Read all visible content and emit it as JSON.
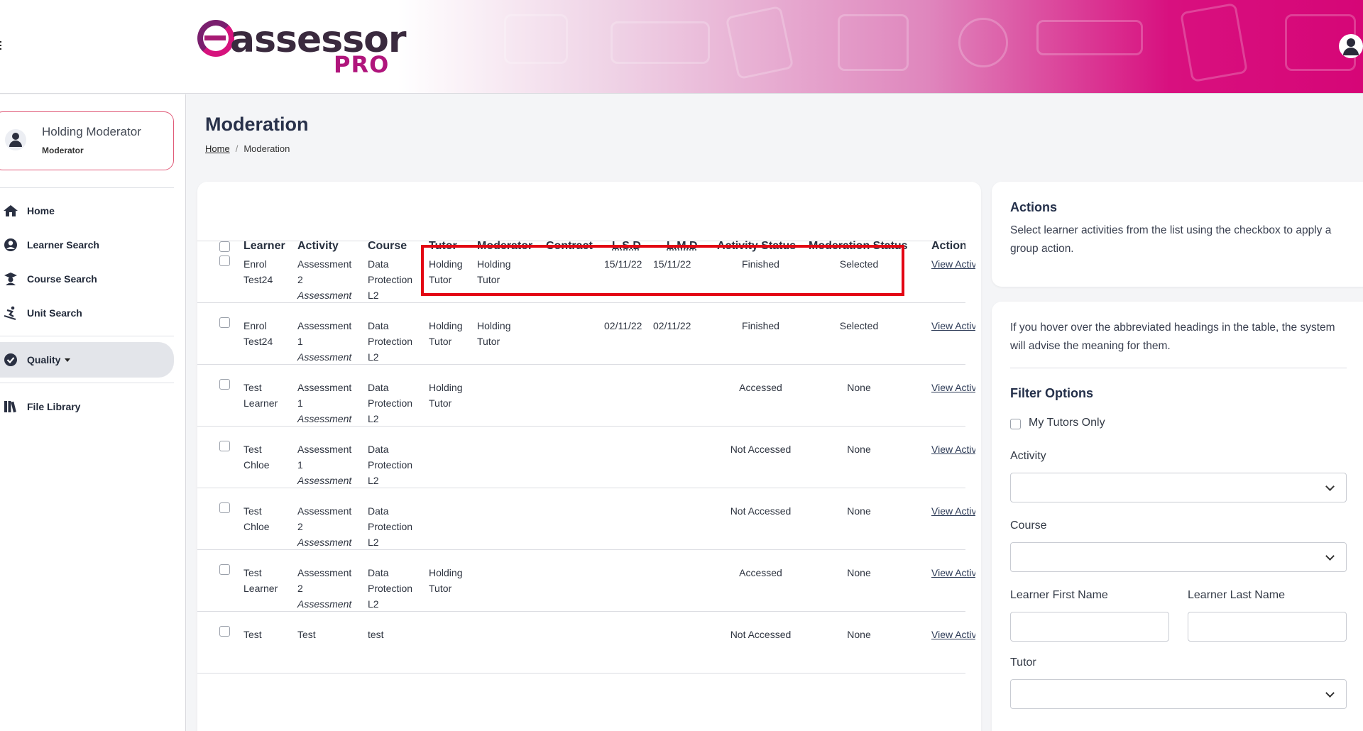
{
  "header": {
    "logo_text": "assessor",
    "logo_pro": "PRO"
  },
  "profile": {
    "name": "Holding Moderator",
    "role": "Moderator"
  },
  "nav": {
    "home": "Home",
    "learner_search": "Learner Search",
    "course_search": "Course Search",
    "unit_search": "Unit Search",
    "quality": "Quality",
    "file_library": "File Library"
  },
  "page": {
    "title": "Moderation",
    "breadcrumb_home": "Home",
    "breadcrumb_sep": "/",
    "breadcrumb_current": "Moderation"
  },
  "table": {
    "headers": {
      "learner": "Learner",
      "activity": "Activity",
      "course": "Course",
      "tutor": "Tutor",
      "moderator": "Moderator",
      "contract": "Contract",
      "lsd": "L.S.D",
      "lmd": "L.M.D",
      "activity_status": "Activity Status",
      "moderation_status": "Moderation Status",
      "action": "Action"
    },
    "rows": [
      {
        "l1": "Enrol",
        "l2": "Test24",
        "a1": "Assessment",
        "a2": "2",
        "a3": "Assessment",
        "c1": "Data",
        "c2": "Protection",
        "c3": "L2",
        "t1": "Holding",
        "t2": "Tutor",
        "m1": "Holding",
        "m2": "Tutor",
        "lsd": "15/11/22",
        "lmd": "15/11/22",
        "astatus": "Finished",
        "mstatus": "Selected",
        "action": "View Activity"
      },
      {
        "l1": "Enrol",
        "l2": "Test24",
        "a1": "Assessment",
        "a2": "1",
        "a3": "Assessment",
        "c1": "Data",
        "c2": "Protection",
        "c3": "L2",
        "t1": "Holding",
        "t2": "Tutor",
        "m1": "Holding",
        "m2": "Tutor",
        "lsd": "02/11/22",
        "lmd": "02/11/22",
        "astatus": "Finished",
        "mstatus": "Selected",
        "action": "View Activity"
      },
      {
        "l1": "Test",
        "l2": "Learner",
        "a1": "Assessment",
        "a2": "1",
        "a3": "Assessment",
        "c1": "Data",
        "c2": "Protection",
        "c3": "L2",
        "t1": "Holding",
        "t2": "Tutor",
        "m1": "",
        "m2": "",
        "lsd": "",
        "lmd": "",
        "astatus": "Accessed",
        "mstatus": "None",
        "action": "View Activity"
      },
      {
        "l1": "Test",
        "l2": "Chloe",
        "a1": "Assessment",
        "a2": "1",
        "a3": "Assessment",
        "c1": "Data",
        "c2": "Protection",
        "c3": "L2",
        "t1": "",
        "t2": "",
        "m1": "",
        "m2": "",
        "lsd": "",
        "lmd": "",
        "astatus": "Not Accessed",
        "mstatus": "None",
        "action": "View Activity"
      },
      {
        "l1": "Test",
        "l2": "Chloe",
        "a1": "Assessment",
        "a2": "2",
        "a3": "Assessment",
        "c1": "Data",
        "c2": "Protection",
        "c3": "L2",
        "t1": "",
        "t2": "",
        "m1": "",
        "m2": "",
        "lsd": "",
        "lmd": "",
        "astatus": "Not Accessed",
        "mstatus": "None",
        "action": "View Activity"
      },
      {
        "l1": "Test",
        "l2": "Learner",
        "a1": "Assessment",
        "a2": "2",
        "a3": "Assessment",
        "c1": "Data",
        "c2": "Protection",
        "c3": "L2",
        "t1": "Holding",
        "t2": "Tutor",
        "m1": "",
        "m2": "",
        "lsd": "",
        "lmd": "",
        "astatus": "Accessed",
        "mstatus": "None",
        "action": "View Activity"
      },
      {
        "l1": "Test",
        "l2": "",
        "a1": "Test",
        "a2": "",
        "a3": "",
        "c1": "test",
        "c2": "",
        "c3": "",
        "t1": "",
        "t2": "",
        "m1": "",
        "m2": "",
        "lsd": "",
        "lmd": "",
        "astatus": "Not Accessed",
        "mstatus": "None",
        "action": "View Activity"
      }
    ]
  },
  "actions_panel": {
    "title": "Actions",
    "text": "Select learner activities from the list using the checkbox to apply a group action."
  },
  "filter_panel": {
    "hint": "If you hover over the abbreviated headings in the table, the system will advise the meaning for them.",
    "title": "Filter Options",
    "my_tutors_only": "My Tutors Only",
    "activity_label": "Activity",
    "course_label": "Course",
    "first_name_label": "Learner First Name",
    "last_name_label": "Learner Last Name",
    "tutor_label": "Tutor"
  },
  "colors": {
    "brand_magenta": "#d6137d",
    "highlight_red": "#e30613",
    "navy_text": "#28314a"
  }
}
